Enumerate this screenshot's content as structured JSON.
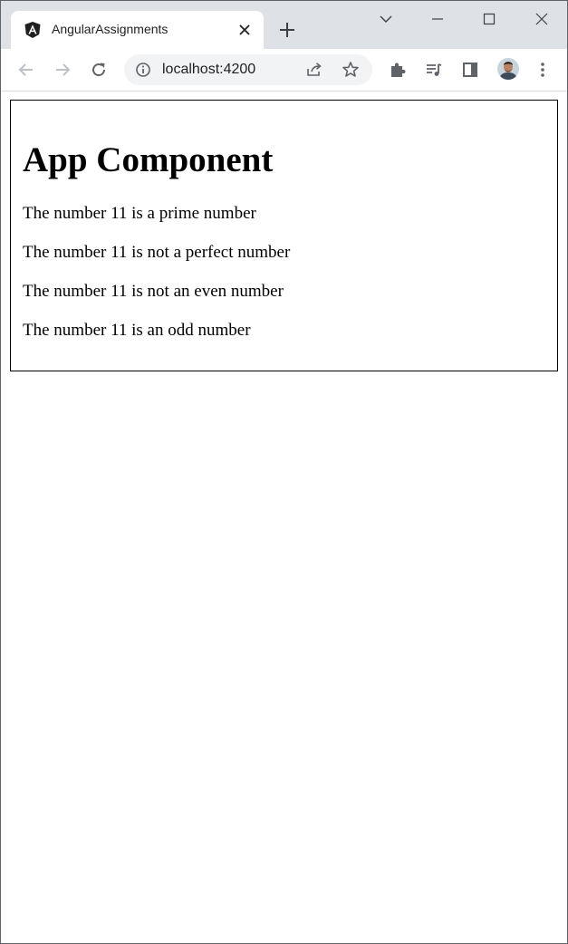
{
  "browser": {
    "tab_title": "AngularAssignments",
    "url": "localhost:4200",
    "icons": {
      "favicon": "angular-logo-icon",
      "close": "close-icon",
      "new_tab": "plus-icon",
      "back": "arrow-left-icon",
      "forward": "arrow-right-icon",
      "reload": "reload-icon",
      "info": "info-icon",
      "share": "share-icon",
      "bookmark": "star-icon",
      "extensions": "puzzle-icon",
      "media": "media-queue-icon",
      "side_panel": "side-panel-icon",
      "menu": "kebab-menu-icon"
    }
  },
  "app": {
    "title": "App Component",
    "lines": [
      "The number 11 is a prime number",
      "The number 11 is not a perfect number",
      "The number 11 is not an even number",
      "The number 11 is an odd number"
    ]
  }
}
